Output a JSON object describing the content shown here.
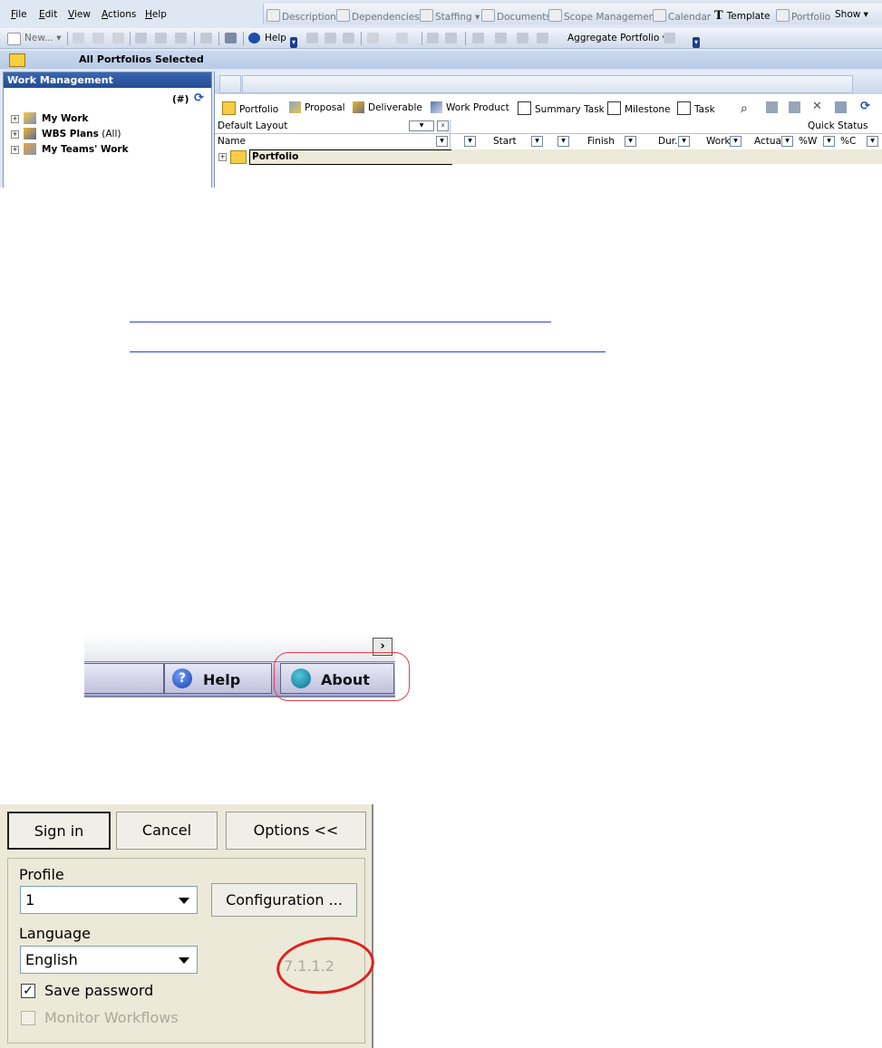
{
  "app": {
    "menus": [
      "File",
      "Edit",
      "View",
      "Actions",
      "Help"
    ],
    "window_toolbar": [
      "Description",
      "Dependencies",
      "Staffing ▾",
      "Documents",
      "Scope Management",
      "Calendar",
      "Template",
      "Portfolio",
      "Show ▾"
    ],
    "toolbar": {
      "new_label": "New... ▾",
      "help_label": "Help",
      "aggregate_label": "Aggregate Portfolio ▾"
    },
    "selection_text": "All Portfolios Selected",
    "left_pane": {
      "title": "Work Management",
      "count_label": "(#)",
      "tree": [
        {
          "label": "My Work",
          "suffix": ""
        },
        {
          "label": "WBS Plans",
          "suffix": "(All)"
        },
        {
          "label": "My Teams' Work",
          "suffix": ""
        }
      ]
    },
    "right_pane": {
      "object_types": [
        "Portfolio",
        "Proposal",
        "Deliverable",
        "Work Product",
        "Summary Task",
        "Milestone",
        "Task"
      ],
      "layout_label": "Default Layout",
      "quick_status": "Quick Status",
      "name_header": "Name",
      "columns": [
        "Start",
        "Finish",
        "Dur.",
        "Work",
        "Actual",
        "%W",
        "%C"
      ],
      "root_row": "Portfolio"
    }
  },
  "about_bar": {
    "help_label": "Help",
    "about_label": "About"
  },
  "signin": {
    "sign_in": "Sign in",
    "cancel": "Cancel",
    "options": "Options <<",
    "profile_label": "Profile",
    "profile_value": "1",
    "configuration": "Configuration ...",
    "language_label": "Language",
    "language_value": "English",
    "version": "7.1.1.2",
    "save_password": "Save password",
    "monitor_workflows": "Monitor Workflows"
  },
  "colors": {
    "highlight_circle": "#e02020",
    "link": "#2f3fd3",
    "header_blue": "#234c93"
  }
}
